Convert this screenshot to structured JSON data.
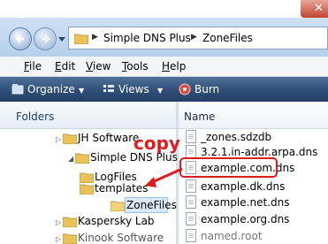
{
  "window": {
    "close_glyph": "✕"
  },
  "address": {
    "crumbs": [
      "Simple DNS Plus",
      "ZoneFiles"
    ]
  },
  "menu": {
    "items": [
      {
        "label": "File",
        "key": "F",
        "rest": "ile"
      },
      {
        "label": "Edit",
        "key": "E",
        "rest": "dit"
      },
      {
        "label": "View",
        "key": "V",
        "rest": "iew"
      },
      {
        "label": "Tools",
        "key": "T",
        "rest": "ools"
      },
      {
        "label": "Help",
        "key": "H",
        "rest": "elp"
      }
    ]
  },
  "toolbar": {
    "organize": "Organize",
    "views": "Views",
    "burn": "Burn"
  },
  "left_pane": {
    "header": "Folders",
    "tree": [
      {
        "label": "JH Software",
        "expander": "▷"
      },
      {
        "label": "Simple DNS Plus",
        "expander": "◢"
      },
      {
        "label": "LogFiles",
        "expander": ""
      },
      {
        "label": "templates",
        "expander": ""
      },
      {
        "label": "ZoneFiles",
        "expander": ""
      },
      {
        "label": "Kaspersky Lab",
        "expander": "▷"
      },
      {
        "label": "Kinook Software",
        "expander": "▷"
      }
    ]
  },
  "right_pane": {
    "header": "Name",
    "files": [
      "_zones.sdzdb",
      "3.2.1.in-addr.arpa.dns",
      "example.com.dns",
      "example.dk.dns",
      "example.net.dns",
      "example.org.dns",
      "named.root"
    ]
  },
  "annotation": {
    "text": "copy",
    "color": "#e01b1b"
  },
  "colors": {
    "toolbar": "#2f4f78",
    "selection": "#dbeaf9",
    "accent_red": "#e01b1b"
  }
}
